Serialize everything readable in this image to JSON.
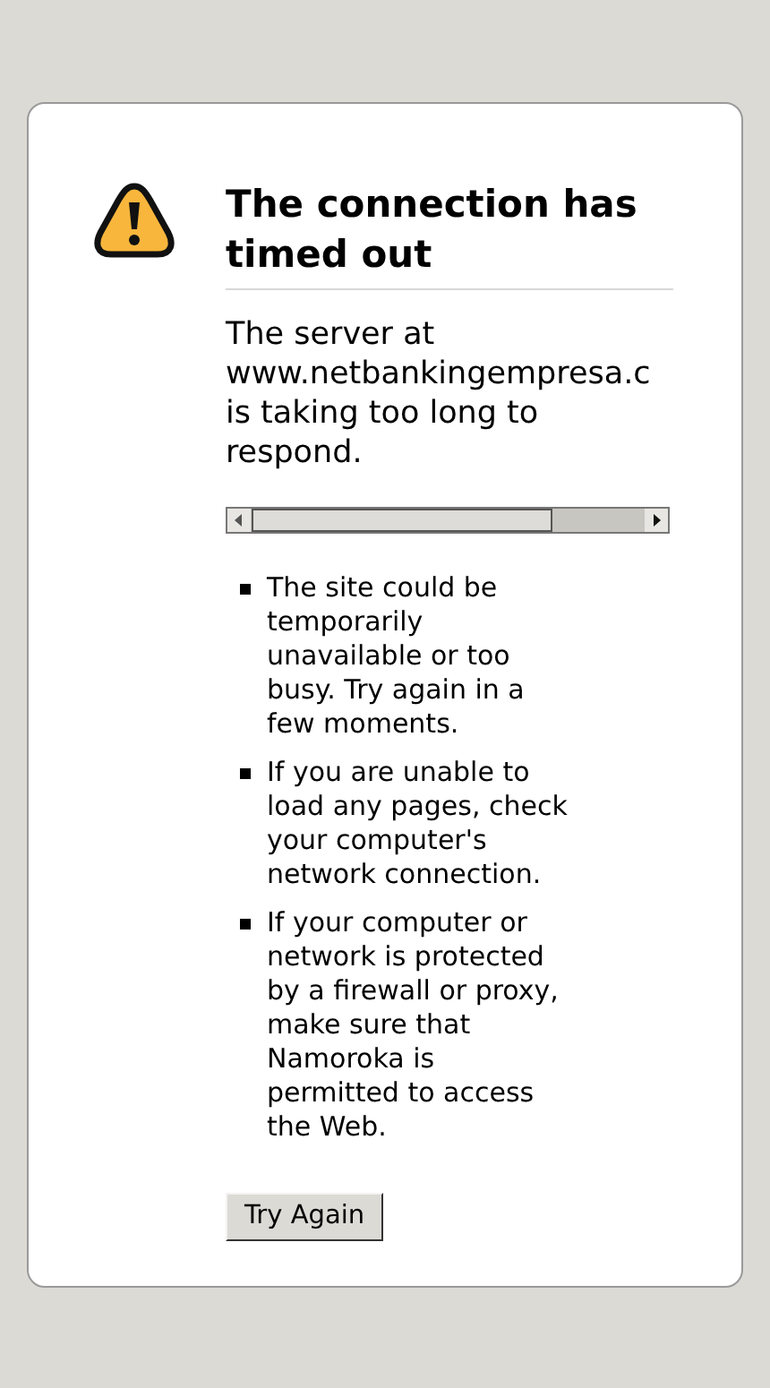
{
  "error_page": {
    "title": "The connection has timed out",
    "message": "The server at www.netbankingempresa.c is taking too long to respond.",
    "suggestions": [
      "The site could be temporarily unavailable or too busy. Try again in a few moments.",
      "If you are unable to load any pages, check your computer's network connection.",
      "If your computer or network is protected by a firewall or proxy, make sure that Namoroka is permitted to access the Web."
    ],
    "button": "Try Again"
  }
}
